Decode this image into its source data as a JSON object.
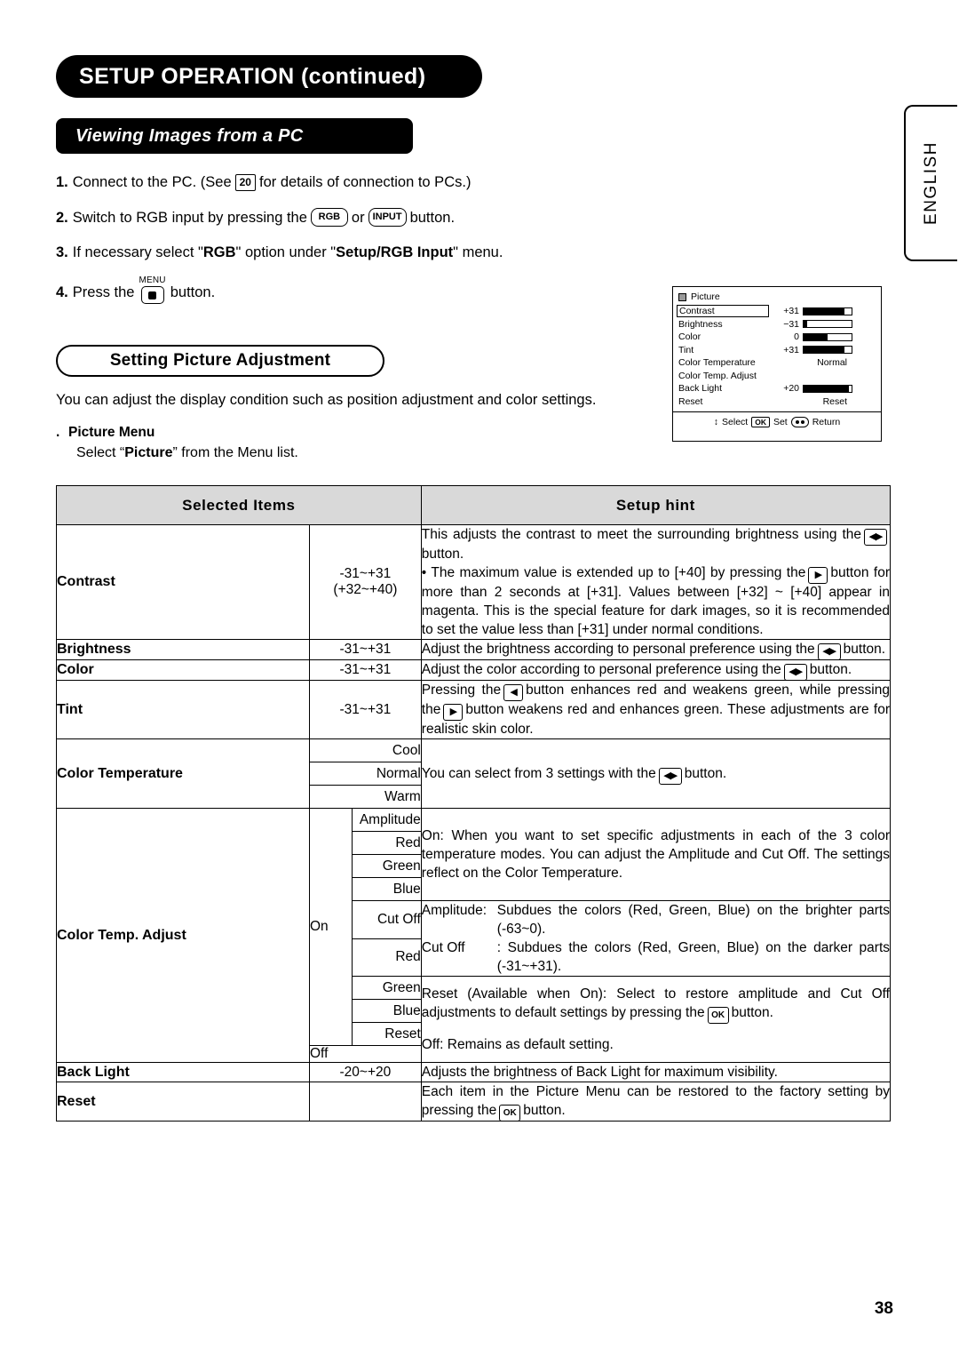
{
  "header": {
    "page_title": "SETUP OPERATION (continued)",
    "section_title": "Viewing Images from a PC",
    "side_tab": "ENGLISH",
    "page_number": "38"
  },
  "steps": [
    {
      "num": "1.",
      "text_before": "Connect to the PC. (See",
      "key": "20",
      "text_after": "for details of connection to PCs.)"
    },
    {
      "num": "2.",
      "text_before": "Switch to RGB input by pressing the",
      "key1": "RGB",
      "mid": "or",
      "key2": "INPUT",
      "text_after": "button."
    },
    {
      "num": "3.",
      "text_before": "If necessary select \"",
      "bold1": "RGB",
      "mid": "\" option under \"",
      "bold2": "Setup/RGB Input",
      "text_after": "\" menu."
    },
    {
      "num": "4.",
      "text_before": "Press the",
      "key_label": "MENU",
      "text_after": "button."
    }
  ],
  "sub_section": {
    "title": "Setting Picture Adjustment",
    "paragraph": "You can adjust the display condition such as position adjustment and color settings.",
    "menu_head": "Picture Menu",
    "menu_sub_pre": "Select “",
    "menu_sub_bold": "Picture",
    "menu_sub_post": "” from the Menu list."
  },
  "osd": {
    "title": "Picture",
    "rows": [
      {
        "name": "Contrast",
        "value": "+31",
        "bar": 85,
        "boxed": true
      },
      {
        "name": "Brightness",
        "value": "−31",
        "bar": 8
      },
      {
        "name": "Color",
        "value": "0",
        "bar": 50
      },
      {
        "name": "Tint",
        "value": "+31",
        "bar": 85
      }
    ],
    "text_rows": [
      {
        "name": "Color Temperature",
        "value": "Normal"
      },
      {
        "name": "Color Temp. Adjust",
        "value": ""
      }
    ],
    "back_light": {
      "name": "Back Light",
      "value": "+20",
      "bar": 95
    },
    "reset": {
      "name": "Reset",
      "value": "Reset"
    },
    "footer": {
      "select": "Select",
      "ok": "OK",
      "set": "Set",
      "return": "Return"
    }
  },
  "table": {
    "headers": {
      "items": "Selected Items",
      "hint": "Setup hint"
    },
    "rows": [
      {
        "name": "Contrast",
        "range_line1": "-31~+31",
        "range_line2": "(+32~+40)",
        "hint_1": "This adjusts the contrast to meet the surrounding brightness using the",
        "hint_1b": "button.",
        "hint_2": "• The maximum value is extended up to [+40] by pressing the",
        "hint_2b": "button for more than 2 seconds at [+31]. Values between [+32] ~ [+40] appear in magenta. This is the special feature for dark images, so it is recommended to set the value less than [+31] under normal conditions."
      },
      {
        "name": "Brightness",
        "range_line1": "-31~+31",
        "hint_1": "Adjust the brightness according to personal preference using the",
        "hint_1b": "button."
      },
      {
        "name": "Color",
        "range_line1": "-31~+31",
        "hint_1": "Adjust the color according to personal preference using the",
        "hint_1b": "button."
      },
      {
        "name": "Tint",
        "range_line1": "-31~+31",
        "hint_1": "Pressing the",
        "hint_1b": "button enhances red and weakens green, while pressing the",
        "hint_1c": "button weakens red and enhances green. These adjustments are for realistic skin color."
      },
      {
        "name": "Color Temperature",
        "sub_items": [
          "Cool",
          "Normal",
          "Warm"
        ],
        "hint_1": "You can select from 3 settings with the",
        "hint_1b": "button."
      },
      {
        "name": "Color Temp. Adjust",
        "on_label": "On",
        "off_label": "Off",
        "sub_items": [
          "Amplitude",
          "Red",
          "Green",
          "Blue",
          "Cut Off",
          "Red",
          "Green",
          "Blue",
          "Reset"
        ],
        "hint_on": "On: When you want to set specific adjustments in each of the 3 color temperature modes. You can adjust the Amplitude and Cut Off. The settings reflect on the Color Temperature.",
        "hint_amp_label": "Amplitude:",
        "hint_amp": "Subdues the colors (Red, Green, Blue) on the brighter parts (-63~0).",
        "hint_cut_label": "Cut Off",
        "hint_cut": ": Subdues the colors (Red, Green, Blue) on the darker parts (-31~+31).",
        "hint_reset_a": "Reset (Available when On): Select to restore amplitude and Cut Off adjustments to default settings by pressing the",
        "hint_reset_key": "OK",
        "hint_reset_b": "button.",
        "hint_off": "Off: Remains as default setting."
      },
      {
        "name": "Back Light",
        "range_line1": "-20~+20",
        "hint_1": "Adjusts the brightness of Back Light for maximum visibility."
      },
      {
        "name": "Reset",
        "hint_1": "Each item in the Picture Menu can be restored to the factory setting by pressing the",
        "hint_key": "OK",
        "hint_1b": "button."
      }
    ]
  }
}
